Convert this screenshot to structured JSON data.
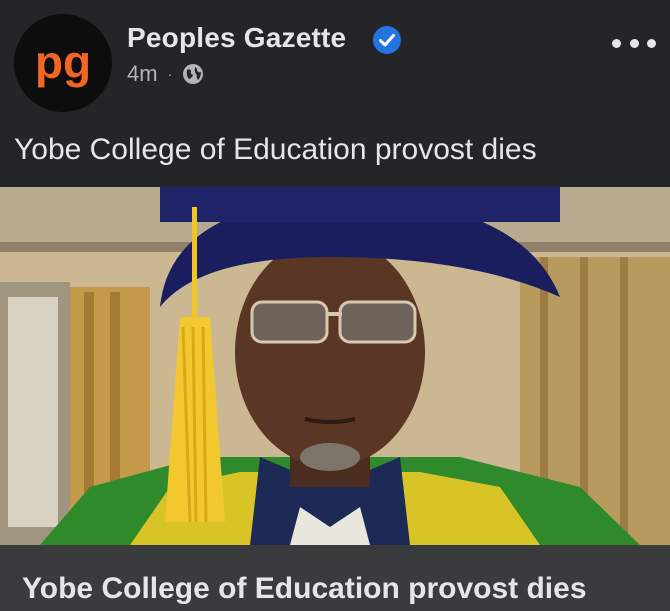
{
  "post": {
    "page_name": "Peoples Gazette",
    "timestamp": "4m",
    "separator": "·",
    "privacy_icon": "globe-icon",
    "avatar_logo_text": "pg",
    "avatar_logo_color": "#f26522",
    "verified_color": "#2374e1",
    "text": "Yobe College of Education provost dies",
    "image_description_icon": "news-photo",
    "link_title": "Yobe College of Education provost dies"
  },
  "colors": {
    "background": "#242526",
    "link_bar": "#3a3b3c",
    "primary_text": "#e4e6eb",
    "secondary_text": "#b0b3b8"
  }
}
